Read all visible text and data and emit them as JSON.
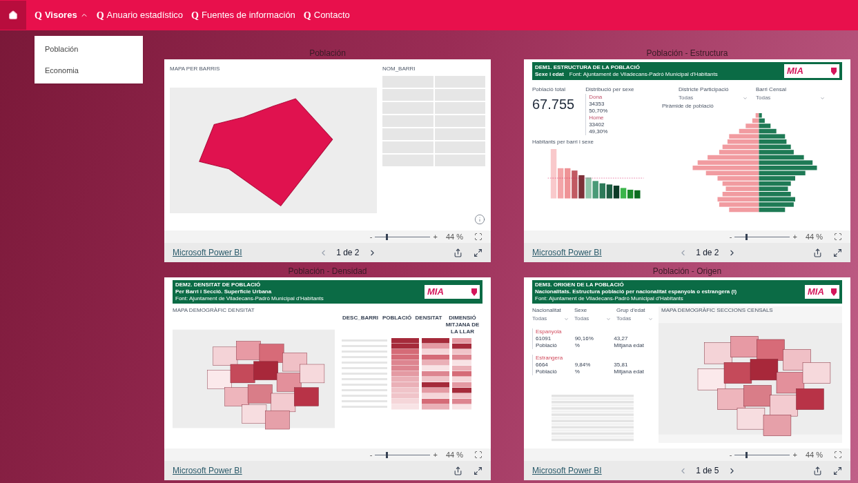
{
  "nav": {
    "home": {
      "selected": true
    },
    "items": [
      {
        "mark": "Q",
        "label": "Visores",
        "kind": "dropdown",
        "expanded": true
      },
      {
        "mark": "Q",
        "label": "Anuario estadístico",
        "kind": "link"
      },
      {
        "mark": "Q",
        "label": "Fuentes de información",
        "kind": "link"
      },
      {
        "mark": "Q",
        "label": "Contacto",
        "kind": "link"
      }
    ]
  },
  "dropdown": {
    "items": [
      "Población",
      "Economia"
    ]
  },
  "panels": [
    {
      "title": "Población",
      "report": {
        "kind": "map_slicer",
        "map_title": "MAPA PER BARRIS",
        "slicer_title": "NOM_BARRI"
      },
      "zoom": {
        "minus": "-",
        "plus": "+",
        "level": 0.2,
        "reading": "44 %"
      },
      "footer": {
        "brand": "Microsoft Power BI",
        "pager": "1 de 2"
      }
    },
    {
      "title": "Población - Estructura",
      "report": {
        "kind": "structure",
        "header": {
          "title": "DEM1. ESTRUCTURA DE LA POBLACIÓ",
          "subtitle": "Sexe i edat",
          "source": "Font: Ajuntament de Viladecans-Padró Municipal d'Habitants",
          "logo": "MIA"
        },
        "total_label": "Població total",
        "total": "67.755",
        "dist_title": "Distribució per sexe",
        "sexes": [
          {
            "label": "Dona",
            "count": "34353",
            "share": "50,70%"
          },
          {
            "label": "Home",
            "count": "33402",
            "share": "49,30%"
          }
        ],
        "filters": [
          {
            "label": "Districte Participació",
            "value": "Todas"
          },
          {
            "label": "Barri Censal",
            "value": "Todas"
          }
        ],
        "bars_title": "Habitants per barri i sexe",
        "pyramid_title": "Piràmide de població"
      },
      "zoom": {
        "minus": "-",
        "plus": "+",
        "level": 0.2,
        "reading": "44 %"
      },
      "footer": {
        "brand": "Microsoft Power BI",
        "pager": "1 de 2"
      }
    },
    {
      "title": "Población - Densidad",
      "report": {
        "kind": "density",
        "header": {
          "title": "DEM2. DENSITAT DE POBLACIÓ",
          "subtitle": "Per Barri i Secció. Superficie Urbana",
          "source": "Font: Ajuntament de Viladecans-Padró Municipal d'Habitants",
          "logo": "MIA"
        },
        "map_title": "MAPA DEMOGRÀFIC DENSITAT",
        "columns": [
          "DESC_BARRI",
          "POBLACIÓ",
          "DENSITAT",
          "DIMENSIÓ MITJANA DE LA LLAR"
        ]
      },
      "zoom": {
        "minus": "-",
        "plus": "+",
        "level": 0.2,
        "reading": "44 %"
      },
      "footer": {
        "brand": "Microsoft Power BI"
      }
    },
    {
      "title": "Población - Origen",
      "report": {
        "kind": "origin",
        "header": {
          "title": "DEM3. ORIGEN DE LA POBLACIÓ",
          "subtitle": "Nacionalitats. Estructura població per nacionalitat espanyola o estrangera (I)",
          "source": "Font: Ajuntament de Viladecans-Padró Municipal d'Habitants",
          "logo": "MIA"
        },
        "filters": [
          {
            "label": "Nacionalitat",
            "value": "Todas"
          },
          {
            "label": "Sexe",
            "value": "Todas"
          },
          {
            "label": "Grup d'edat",
            "value": "Todas"
          }
        ],
        "groups": [
          {
            "label": "Espanyola",
            "count": "61091",
            "count_label": "Població",
            "share": "90,16%",
            "share_label": "%",
            "age": "43,27",
            "age_label": "Mitjana edat"
          },
          {
            "label": "Estrangera",
            "count": "6664",
            "count_label": "Població",
            "share": "9,84%",
            "share_label": "%",
            "age": "35,81",
            "age_label": "Mitjana edat"
          }
        ],
        "map_title": "MAPA DEMOGRÀFIC SECCIONS CENSALS"
      },
      "zoom": {
        "minus": "-",
        "plus": "+",
        "level": 0.2,
        "reading": "44 %"
      },
      "footer": {
        "brand": "Microsoft Power BI",
        "pager": "1 de 5"
      }
    }
  ]
}
